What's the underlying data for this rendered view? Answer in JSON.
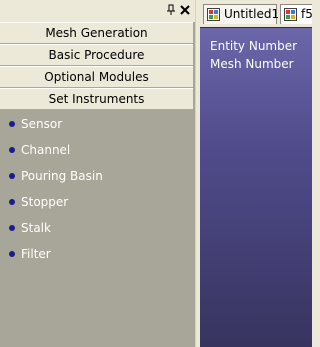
{
  "panel": {
    "pin_glyph": "▕",
    "close_glyph": "×"
  },
  "categories": [
    {
      "label": "Mesh Generation"
    },
    {
      "label": "Basic Procedure"
    },
    {
      "label": "Optional Modules"
    },
    {
      "label": "Set Instruments"
    }
  ],
  "instruments": [
    {
      "label": "Sensor",
      "icon": "bullet-icon"
    },
    {
      "label": "Channel",
      "icon": "bullet-icon"
    },
    {
      "label": "Pouring Basin",
      "icon": "bullet-icon"
    },
    {
      "label": "Stopper",
      "icon": "bullet-icon"
    },
    {
      "label": "Stalk",
      "icon": "bullet-icon"
    },
    {
      "label": "Filter",
      "icon": "bullet-icon"
    }
  ],
  "tabs": [
    {
      "label": "Untitled1",
      "icon": "document-icon"
    },
    {
      "label": "f5",
      "icon": "document-icon"
    }
  ],
  "viewport": {
    "lines": [
      "Entity Number",
      "Mesh Number"
    ]
  },
  "colors": {
    "panel_background": "#a8a698",
    "button_face": "#ece9d8",
    "bullet": "#1b1b8e",
    "viewport_top": "#6b66a8",
    "viewport_bottom": "#37345f"
  }
}
